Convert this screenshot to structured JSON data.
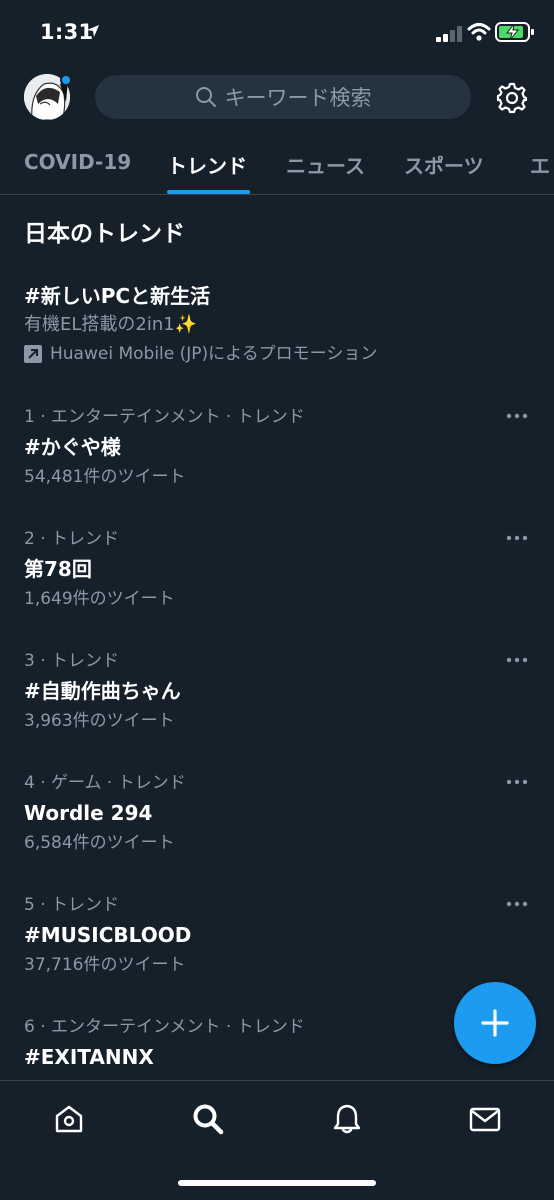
{
  "status_bar": {
    "time": "1:31"
  },
  "header": {
    "search_placeholder": "キーワード検索"
  },
  "tabs": [
    {
      "label": "COVID-19"
    },
    {
      "label": "トレンド"
    },
    {
      "label": "ニュース"
    },
    {
      "label": "スポーツ"
    },
    {
      "label": "エ"
    }
  ],
  "section_title": "日本のトレンド",
  "promo": {
    "title": "#新しいPCと新生活",
    "description": "有機EL搭載の2in1✨",
    "promoted_by": "Huawei Mobile (JP)によるプロモーション"
  },
  "trends": [
    {
      "meta": "1 · エンターテインメント · トレンド",
      "name": "#かぐや様",
      "count": "54,481件のツイート"
    },
    {
      "meta": "2 · トレンド",
      "name": "第78回",
      "count": "1,649件のツイート"
    },
    {
      "meta": "3 · トレンド",
      "name": "#自動作曲ちゃん",
      "count": "3,963件のツイート"
    },
    {
      "meta": "4 · ゲーム · トレンド",
      "name": "Wordle 294",
      "count": "6,584件のツイート"
    },
    {
      "meta": "5 · トレンド",
      "name": "#MUSICBLOOD",
      "count": "37,716件のツイート"
    },
    {
      "meta": "6 · エンターテインメント · トレンド",
      "name": "#EXITANNX",
      "count": ""
    }
  ],
  "colors": {
    "background": "#15202b",
    "accent": "#1d9bf0",
    "secondary_text": "#8b98a5",
    "battery": "#4cd964"
  }
}
